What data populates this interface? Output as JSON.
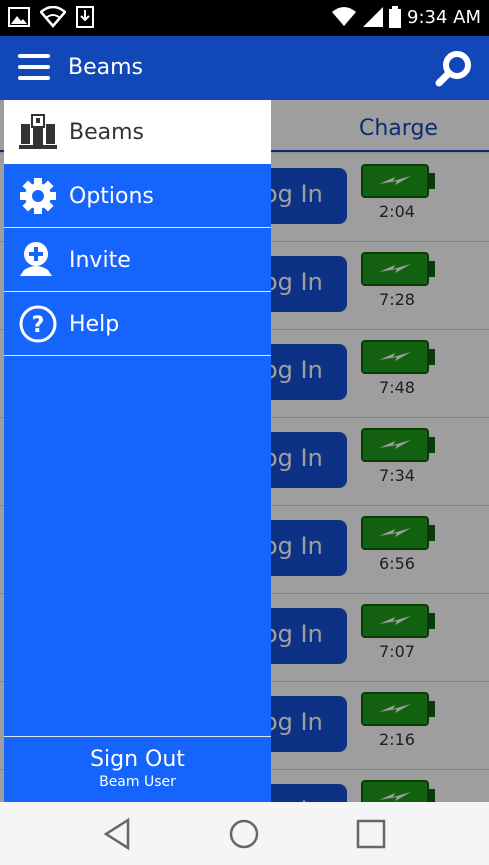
{
  "status_bar": {
    "time": "9:34 AM"
  },
  "app_bar": {
    "title": "Beams"
  },
  "table": {
    "column_charge": "Charge"
  },
  "rows": [
    {
      "action": "Log In",
      "charge_time": "2:04"
    },
    {
      "action": "Log In",
      "charge_time": "7:28"
    },
    {
      "action": "Log In",
      "charge_time": "7:48"
    },
    {
      "action": "Log In",
      "charge_time": "7:34"
    },
    {
      "action": "Log In",
      "charge_time": "6:56"
    },
    {
      "action": "Log In",
      "charge_time": "7:07"
    },
    {
      "action": "Log In",
      "charge_time": "2:16"
    },
    {
      "action": "Log In",
      "charge_time": ""
    }
  ],
  "drawer": {
    "items": [
      {
        "label": "Beams",
        "icon": "beams-icon",
        "active": true
      },
      {
        "label": "Options",
        "icon": "gear-icon"
      },
      {
        "label": "Invite",
        "icon": "add-user-icon"
      },
      {
        "label": "Help",
        "icon": "help-icon"
      }
    ],
    "sign_out": "Sign Out",
    "user_name": "Beam User"
  },
  "colors": {
    "app_bar": "#1247b8",
    "drawer": "#1565fc",
    "battery": "#1e9e1e"
  }
}
